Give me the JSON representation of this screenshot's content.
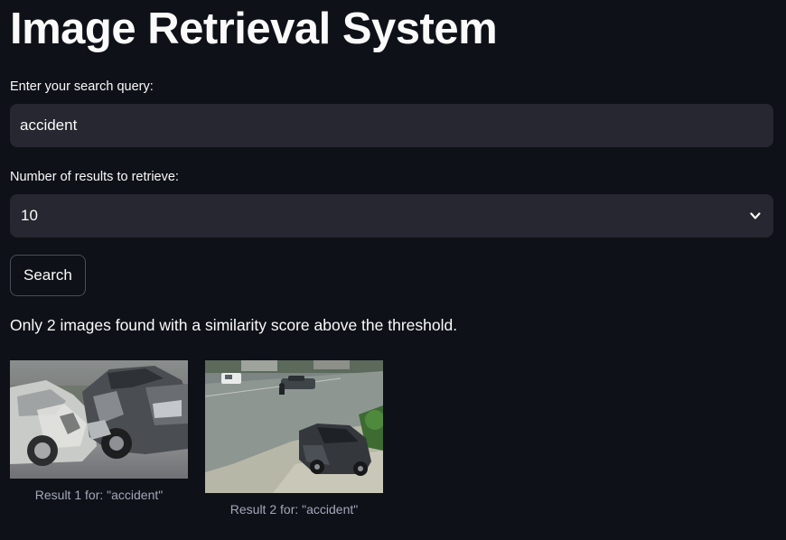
{
  "app": {
    "title": "Image Retrieval System"
  },
  "query_field": {
    "label": "Enter your search query:",
    "value": "accident"
  },
  "count_field": {
    "label": "Number of results to retrieve:",
    "selected": "10",
    "icon": "chevron-down-icon"
  },
  "search_button": {
    "label": "Search"
  },
  "status": {
    "message": "Only 2 images found with a similarity score above the threshold."
  },
  "results": [
    {
      "caption": "Result 1 for: \"accident\"",
      "image_desc": "wrecked silver cars after collision"
    },
    {
      "caption": "Result 2 for: \"accident\"",
      "image_desc": "CCTV view of street intersection with dark sedan"
    }
  ],
  "colors": {
    "background": "#0e1117",
    "input_bg": "#262730",
    "text": "#fafafa",
    "caption": "#a3a8b8",
    "button_border": "#4b4d57"
  }
}
